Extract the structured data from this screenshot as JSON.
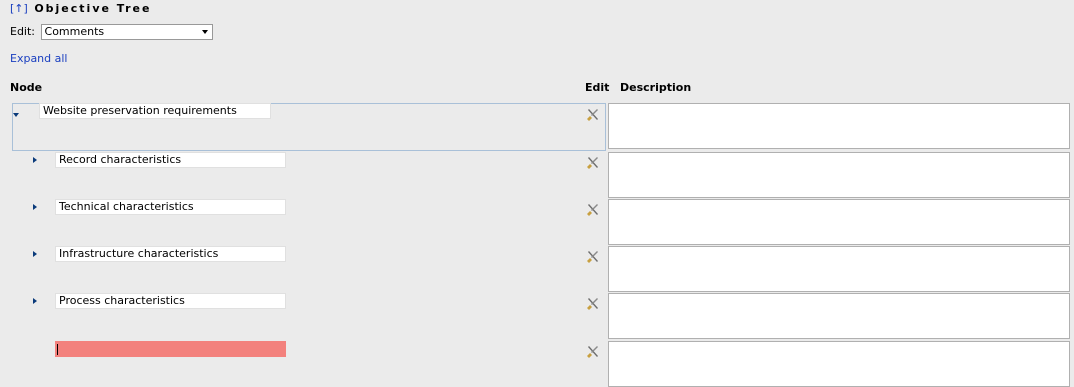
{
  "header": {
    "up_link": "[↑]",
    "title": "Objective Tree"
  },
  "edit_control": {
    "label": "Edit:",
    "selected": "Comments"
  },
  "expand_all": "Expand all",
  "columns": {
    "node": "Node",
    "edit": "Edit",
    "description": "Description"
  },
  "rows": [
    {
      "label": "Website preservation requirements",
      "toggle": "expanded",
      "level": 0,
      "description": ""
    },
    {
      "label": "Record characteristics",
      "toggle": "collapsed",
      "level": 1,
      "description": ""
    },
    {
      "label": "Technical characteristics",
      "toggle": "collapsed",
      "level": 1,
      "description": ""
    },
    {
      "label": "Infrastructure characteristics",
      "toggle": "collapsed",
      "level": 1,
      "description": ""
    },
    {
      "label": "Process characteristics",
      "toggle": "collapsed",
      "level": 1,
      "description": ""
    },
    {
      "label": "",
      "toggle": "none",
      "level": 1,
      "description": "",
      "state": "error"
    }
  ],
  "icons": {
    "edit": "tools-icon",
    "toggle_expanded": "triangle-down-icon",
    "toggle_collapsed": "triangle-right-icon"
  },
  "colors": {
    "link": "#1a3fc0",
    "error_field": "#f3817d",
    "background": "#ebebeb"
  }
}
